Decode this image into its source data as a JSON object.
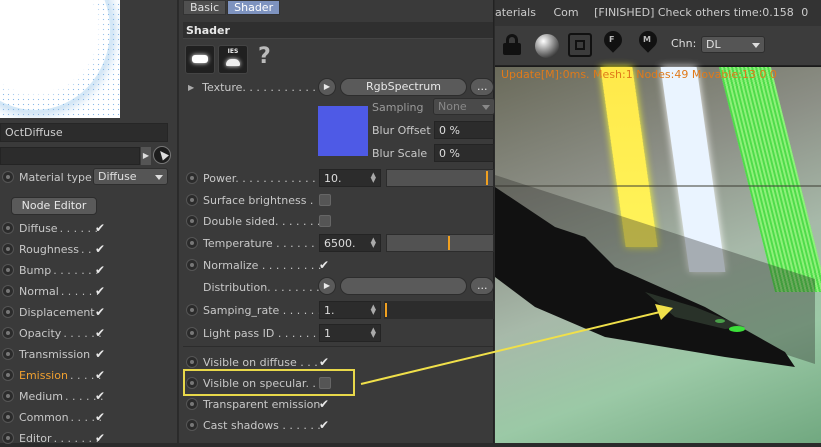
{
  "left": {
    "material_name": "OctDiffuse",
    "material_type_label": "Material type",
    "material_type_value": "Diffuse",
    "node_editor_label": "Node Editor",
    "channels": [
      {
        "label": "Diffuse",
        "dots": ". . . . . .",
        "checked": true,
        "active": false
      },
      {
        "label": "Roughness",
        "dots": ". .",
        "checked": true,
        "active": false
      },
      {
        "label": "Bump",
        "dots": ". . . . . . .",
        "checked": true,
        "active": false
      },
      {
        "label": "Normal",
        "dots": ". . . . . .",
        "checked": true,
        "active": false
      },
      {
        "label": "Displacement",
        "dots": "",
        "checked": true,
        "active": false
      },
      {
        "label": "Opacity",
        "dots": ". . . . . .",
        "checked": true,
        "active": false
      },
      {
        "label": "Transmission",
        "dots": "",
        "checked": true,
        "active": false
      },
      {
        "label": "Emission",
        "dots": ". . . . .",
        "checked": true,
        "active": true
      },
      {
        "label": "Medium",
        "dots": ". . . . . .",
        "checked": true,
        "active": false
      },
      {
        "label": "Common",
        "dots": ". . . . .",
        "checked": true,
        "active": false
      },
      {
        "label": "Editor",
        "dots": ". . . . . . .",
        "checked": true,
        "active": false
      }
    ]
  },
  "mid": {
    "tabs": [
      "Basic",
      "Shader"
    ],
    "active_tab": "Shader",
    "section_title": "Shader",
    "help_glyph": "?",
    "texture_label": "Texture. . . . . . . . . . . .",
    "texture_button": "RgbSpectrum",
    "texture_more": "...",
    "sampling_label": "Sampling",
    "sampling_value": "None",
    "blur_offset_label": "Blur Offset",
    "blur_offset_value": "0 %",
    "blur_scale_label": "Blur Scale",
    "blur_scale_value": "0 %",
    "power_label": "Power. . . . . . . . . . . . .",
    "power_value": "10.",
    "surface_brightness_label": "Surface brightness .",
    "double_sided_label": "Double sided. . . . . . .",
    "temperature_label": "Temperature . . . . . . .",
    "temperature_value": "6500.",
    "normalize_label": "Normalize . . . . . . . . .",
    "distribution_label": "Distribution. . . . . . . .",
    "samping_rate_label": "Samping_rate . . . . . .",
    "samping_rate_value": "1.",
    "light_pass_label": "Light pass ID . . . . . . .",
    "light_pass_value": "1",
    "visible_diffuse_label": "Visible on diffuse . . .",
    "visible_specular_label": "Visible on specular. .",
    "transparent_emission_label": "Transparent emission",
    "cast_shadows_label": "Cast shadows . . . . . .",
    "swatch_color": "#4e5ae6",
    "power_fraction": 0.97,
    "temperature_fraction": 0.6,
    "samping_rate_fraction": 0.0
  },
  "viewport": {
    "topbar_menu1": "aterials",
    "topbar_menu2": "Com",
    "topbar_status": "[FINISHED] Check others time:0.158",
    "topbar_trailing": "0",
    "chn_label": "Chn:",
    "chn_value": "DL",
    "status_line": "Update[M]:0ms. Mesh:1 Nodes:49 Movable:13  0 0",
    "icons": [
      "lock-icon",
      "material-ball-icon",
      "region-icon",
      "focus-pin-icon",
      "material-pin-icon"
    ]
  }
}
